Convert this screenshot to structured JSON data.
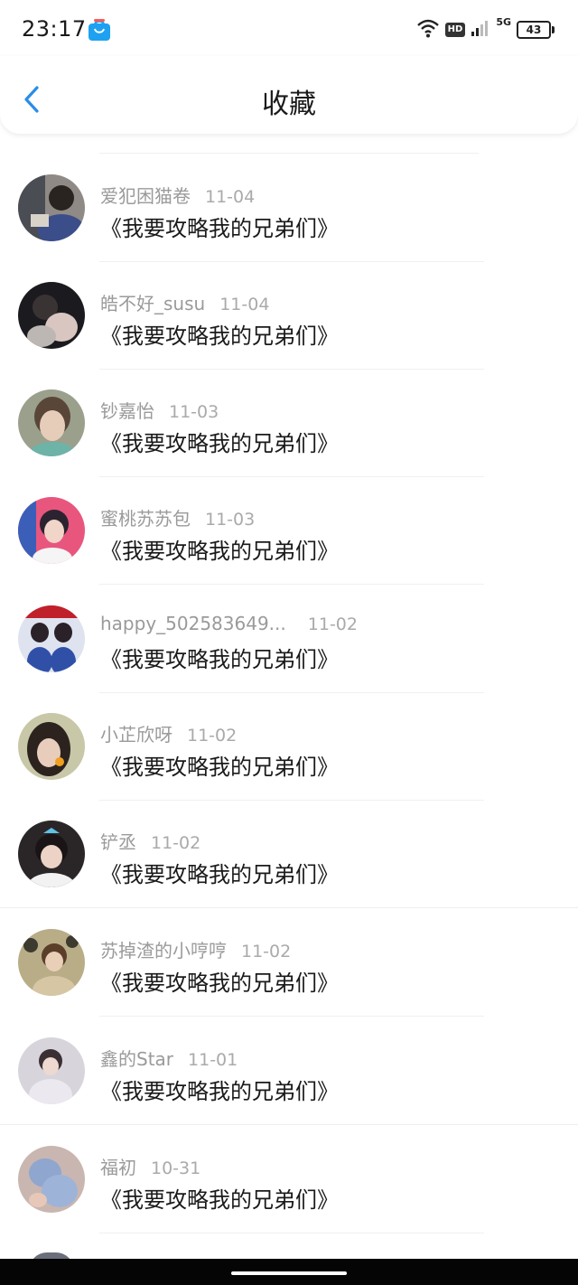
{
  "status_bar": {
    "time": "23:17",
    "hd": "HD",
    "network": "5G",
    "battery": "43"
  },
  "header": {
    "title": "收藏"
  },
  "items": [
    {
      "name": "爱犯困猫卷",
      "date": "11-04",
      "title": "《我要攻略我的兄弟们》"
    },
    {
      "name": "皓不好_susu",
      "date": "11-04",
      "title": "《我要攻略我的兄弟们》"
    },
    {
      "name": "钞嘉怡",
      "date": "11-03",
      "title": "《我要攻略我的兄弟们》"
    },
    {
      "name": "蜜桃苏苏包",
      "date": "11-03",
      "title": "《我要攻略我的兄弟们》"
    },
    {
      "name": "happy_502583649...",
      "date": "11-02",
      "title": "《我要攻略我的兄弟们》"
    },
    {
      "name": "小芷欣呀",
      "date": "11-02",
      "title": "《我要攻略我的兄弟们》"
    },
    {
      "name": "铲丞",
      "date": "11-02",
      "title": "《我要攻略我的兄弟们》"
    },
    {
      "name": "苏掉渣的小哼哼",
      "date": "11-02",
      "title": "《我要攻略我的兄弟们》"
    },
    {
      "name": "鑫的Star",
      "date": "11-01",
      "title": "《我要攻略我的兄弟们》"
    },
    {
      "name": "福初",
      "date": "10-31",
      "title": "《我要攻略我的兄弟们》"
    }
  ],
  "icons": {
    "back": "chevron-left-icon",
    "wifi": "wifi-icon",
    "signal": "signal-icon",
    "app": "shopping-bag-icon"
  },
  "colors": {
    "accent": "#2b8de6",
    "name_text": "#9a9a9a",
    "title_text": "#1a1a1a"
  }
}
